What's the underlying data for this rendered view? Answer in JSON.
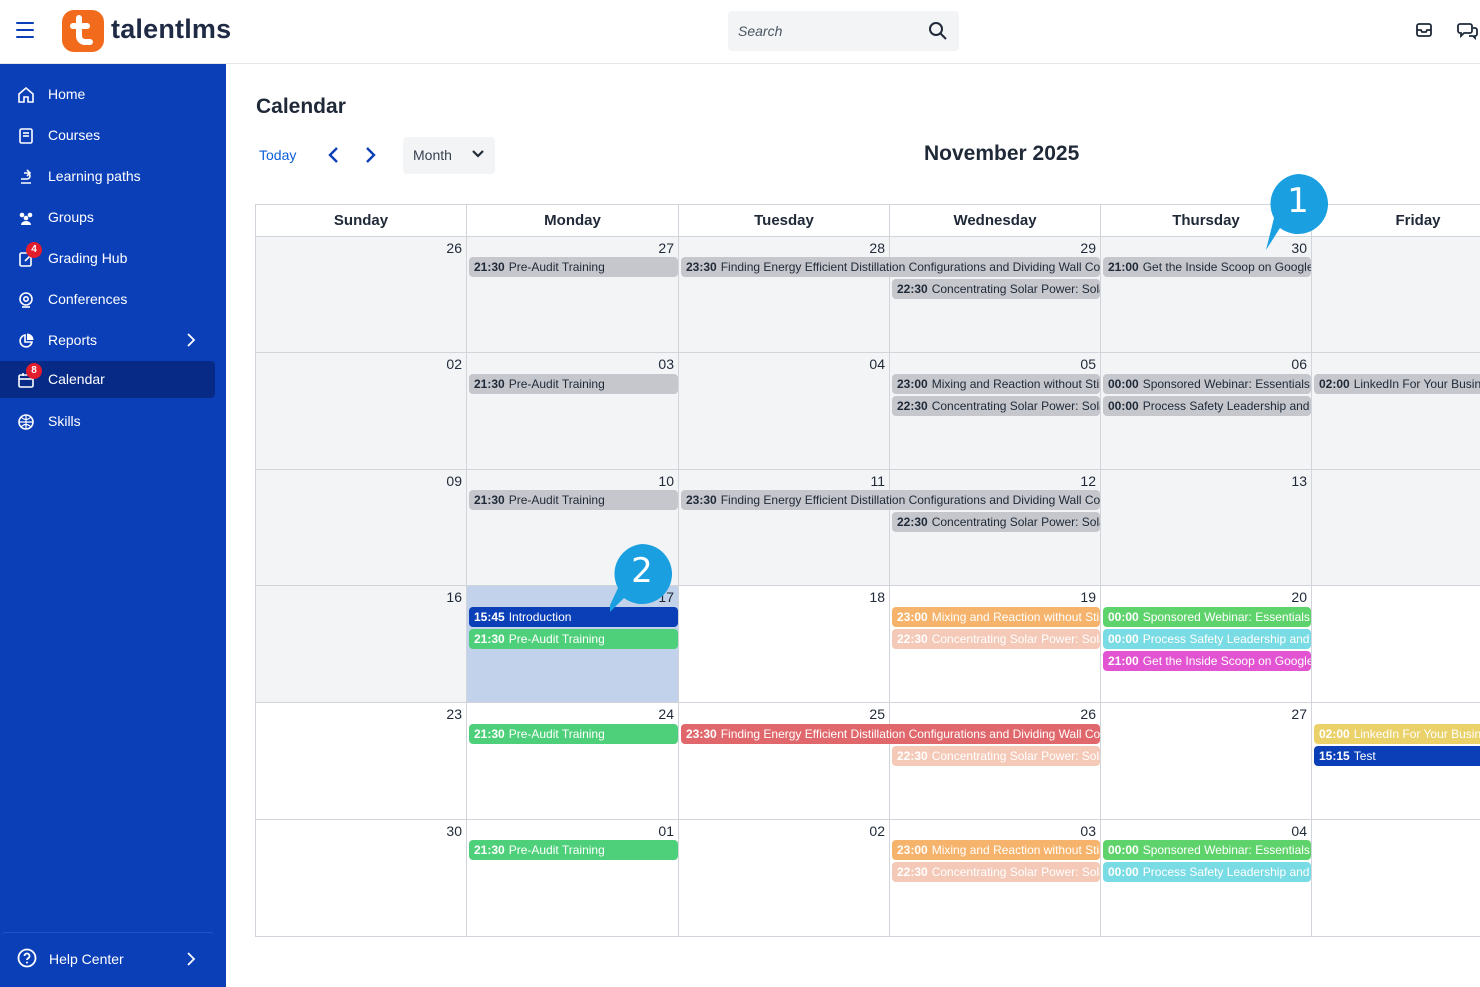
{
  "topbar": {
    "brand": "talentlms",
    "search_placeholder": "Search"
  },
  "sidebar": {
    "items": [
      {
        "label": "Home",
        "icon": "home-icon"
      },
      {
        "label": "Courses",
        "icon": "courses-icon"
      },
      {
        "label": "Learning paths",
        "icon": "learning-paths-icon"
      },
      {
        "label": "Groups",
        "icon": "groups-icon"
      },
      {
        "label": "Grading Hub",
        "icon": "grading-hub-icon",
        "badge": "4"
      },
      {
        "label": "Conferences",
        "icon": "conferences-icon"
      },
      {
        "label": "Reports",
        "icon": "reports-icon"
      },
      {
        "label": "Calendar",
        "icon": "calendar-icon",
        "badge": "8",
        "active": true
      },
      {
        "label": "Skills",
        "icon": "skills-icon"
      }
    ],
    "help": "Help Center"
  },
  "calendar": {
    "title": "Calendar",
    "today_label": "Today",
    "view": "Month",
    "month_title": "November 2025",
    "weekdays": [
      "Sunday",
      "Monday",
      "Tuesday",
      "Wednesday",
      "Thursday",
      "Friday"
    ],
    "weeks": [
      [
        "26",
        "27",
        "28",
        "29",
        "30",
        ""
      ],
      [
        "02",
        "03",
        "04",
        "05",
        "06",
        ""
      ],
      [
        "09",
        "10",
        "11",
        "12",
        "13",
        ""
      ],
      [
        "16",
        "17",
        "18",
        "19",
        "20",
        ""
      ],
      [
        "23",
        "24",
        "25",
        "26",
        "27",
        ""
      ],
      [
        "30",
        "01",
        "02",
        "03",
        "04",
        ""
      ]
    ],
    "events": {
      "w1_mon": {
        "time": "21:30",
        "title": "Pre-Audit Training"
      },
      "w1_tue": {
        "time": "23:30",
        "title": "Finding Energy Efficient Distillation Configurations and Dividing Wall Colur"
      },
      "w1_wed": {
        "time": "22:30",
        "title": "Concentrating Solar Power: Sola"
      },
      "w1_thu": {
        "time": "21:00",
        "title": "Get the Inside Scoop on Google A"
      },
      "w2_mon": {
        "time": "21:30",
        "title": "Pre-Audit Training"
      },
      "w2_wed1": {
        "time": "23:00",
        "title": "Mixing and Reaction without Stir"
      },
      "w2_wed2": {
        "time": "22:30",
        "title": "Concentrating Solar Power: Sola"
      },
      "w2_thu1": {
        "time": "00:00",
        "title": "Sponsored Webinar: Essentials c"
      },
      "w2_thu2": {
        "time": "00:00",
        "title": "Process Safety Leadership and tl"
      },
      "w2_fri": {
        "time": "02:00",
        "title": "LinkedIn For Your Busines"
      },
      "w3_mon": {
        "time": "21:30",
        "title": "Pre-Audit Training"
      },
      "w3_tue": {
        "time": "23:30",
        "title": "Finding Energy Efficient Distillation Configurations and Dividing Wall Colur"
      },
      "w3_wed": {
        "time": "22:30",
        "title": "Concentrating Solar Power: Sola"
      },
      "w4_mon1": {
        "time": "15:45",
        "title": "Introduction"
      },
      "w4_mon2": {
        "time": "21:30",
        "title": "Pre-Audit Training"
      },
      "w4_wed1": {
        "time": "23:00",
        "title": "Mixing and Reaction without Stir"
      },
      "w4_wed2": {
        "time": "22:30",
        "title": "Concentrating Solar Power: Sola"
      },
      "w4_thu1": {
        "time": "00:00",
        "title": "Sponsored Webinar: Essentials c"
      },
      "w4_thu2": {
        "time": "00:00",
        "title": "Process Safety Leadership and tl"
      },
      "w4_thu3": {
        "time": "21:00",
        "title": "Get the Inside Scoop on Google A"
      },
      "w5_mon": {
        "time": "21:30",
        "title": "Pre-Audit Training"
      },
      "w5_tue": {
        "time": "23:30",
        "title": "Finding Energy Efficient Distillation Configurations and Dividing Wall Colur"
      },
      "w5_wed": {
        "time": "22:30",
        "title": "Concentrating Solar Power: Sola"
      },
      "w5_fri1": {
        "time": "02:00",
        "title": "LinkedIn For Your Busines"
      },
      "w5_fri2": {
        "time": "15:15",
        "title": "Test"
      },
      "w6_mon": {
        "time": "21:30",
        "title": "Pre-Audit Training"
      },
      "w6_wed1": {
        "time": "23:00",
        "title": "Mixing and Reaction without Stir"
      },
      "w6_wed2": {
        "time": "22:30",
        "title": "Concentrating Solar Power: Sola"
      },
      "w6_thu1": {
        "time": "00:00",
        "title": "Sponsored Webinar: Essentials c"
      },
      "w6_thu2": {
        "time": "00:00",
        "title": "Process Safety Leadership and tl"
      }
    }
  },
  "callouts": {
    "one": "1",
    "two": "2"
  },
  "colors": {
    "sidebar": "#0b3fb8",
    "brand_orange": "#f26b1d",
    "callout": "#1a9fe0"
  }
}
